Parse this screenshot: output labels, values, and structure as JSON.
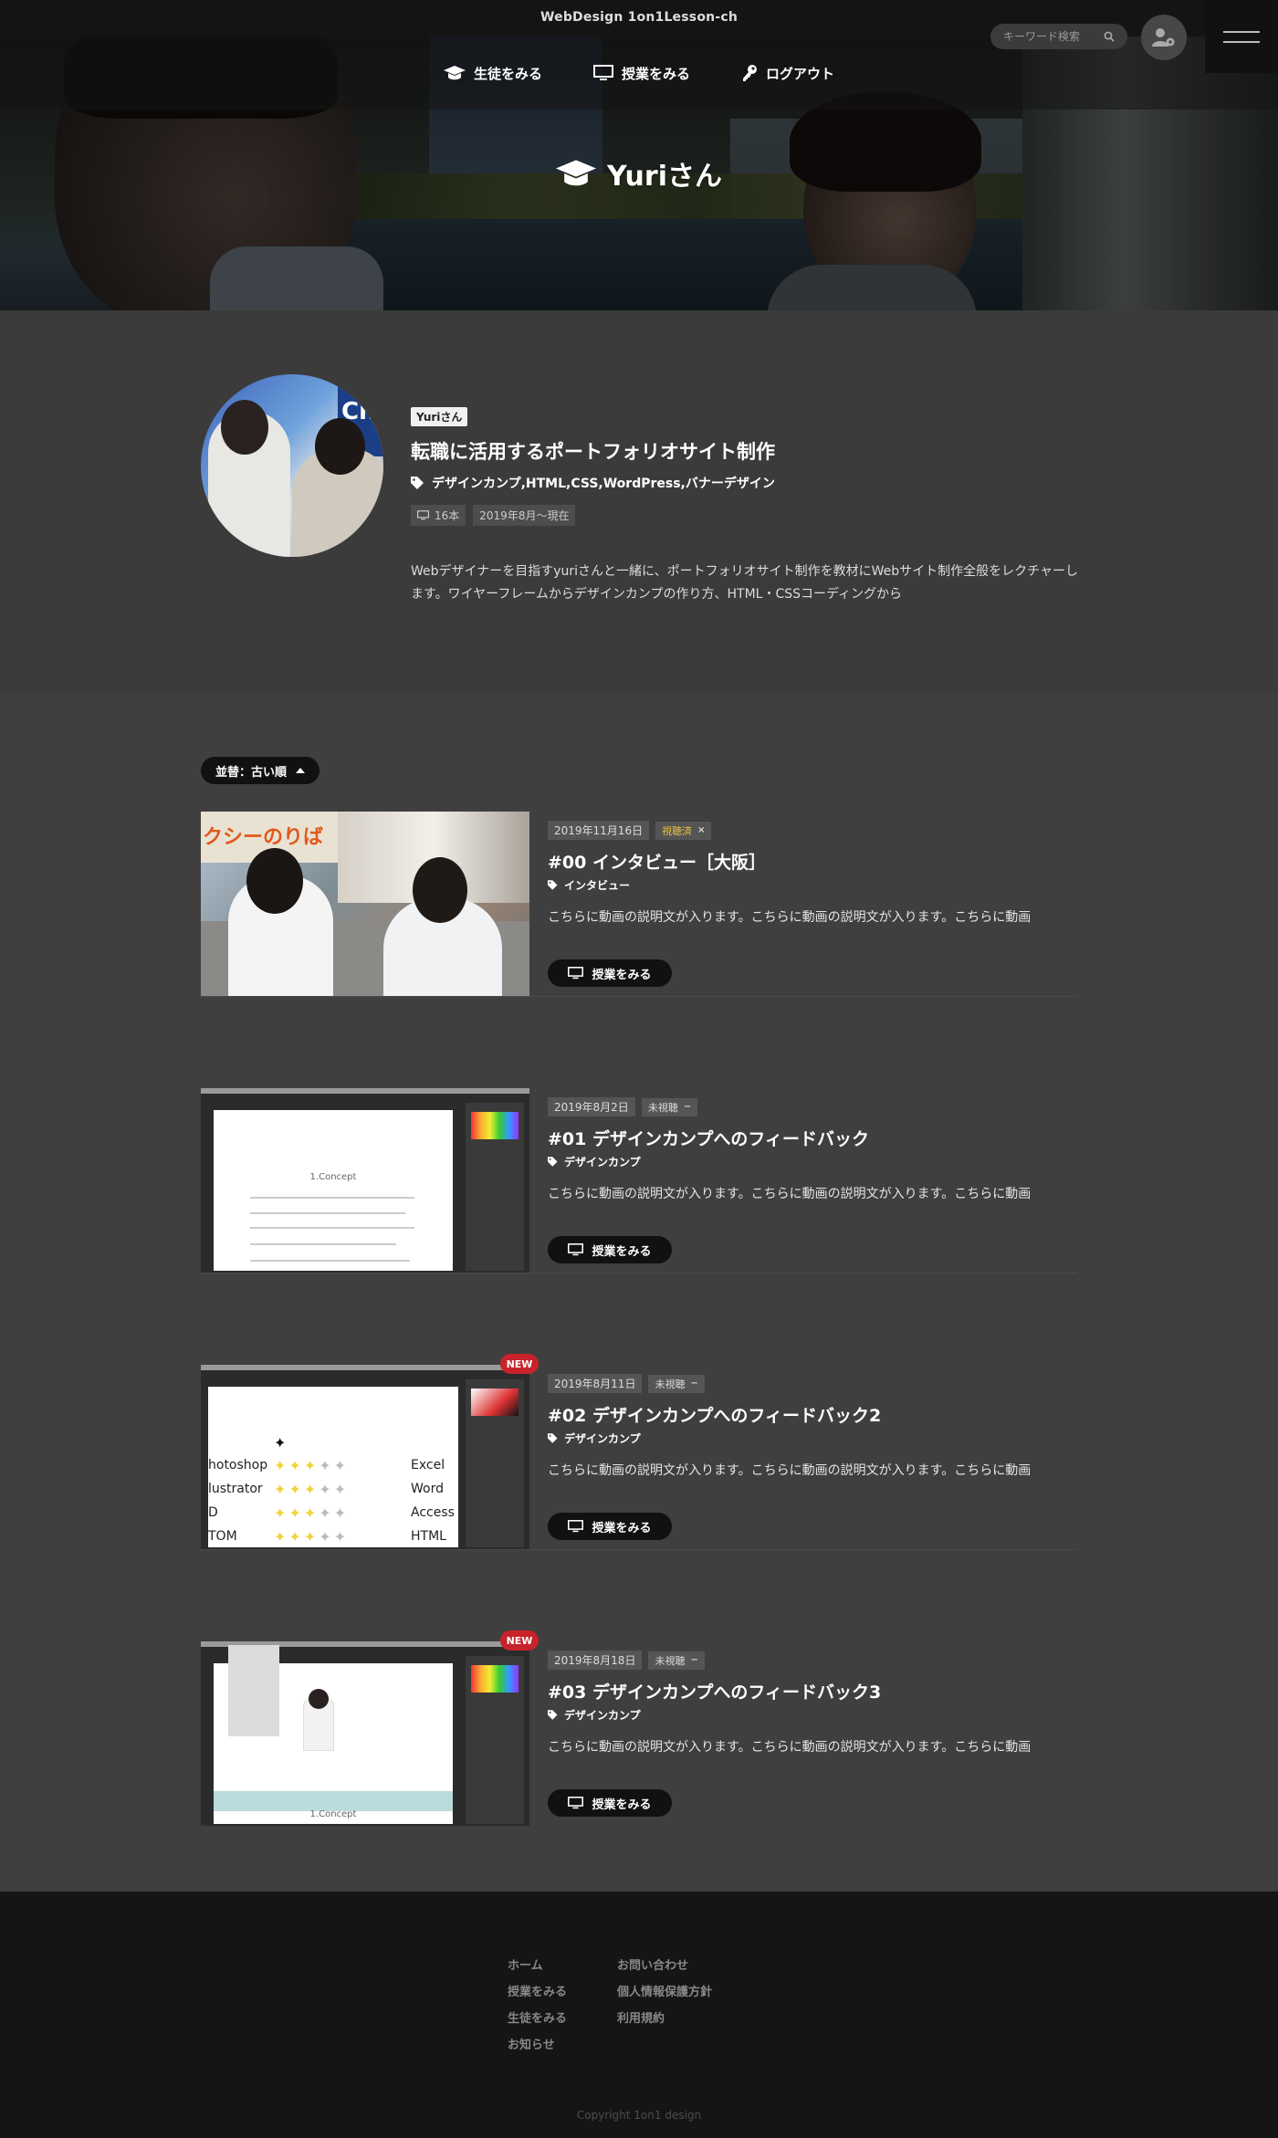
{
  "header": {
    "site_title": "WebDesign 1on1Lesson-ch",
    "search_placeholder": "キーワード検索",
    "nav": [
      {
        "label": "生徒をみる",
        "icon": "graduation-cap-icon"
      },
      {
        "label": "授業をみる",
        "icon": "monitor-icon"
      },
      {
        "label": "ログアウト",
        "icon": "key-icon"
      }
    ]
  },
  "hero": {
    "title": "Yuriさん"
  },
  "profile": {
    "name_tag": "Yuriさん",
    "title": "転職に活用するポートフォリオサイト制作",
    "tags": "デザインカンプ,HTML,CSS,WordPress,バナーデザイン",
    "lesson_count": "16本",
    "period": "2019年8月〜現在",
    "description": "Webデザイナーを目指すyuriさんと一緒に、ポートフォリオサイト制作を教材にWebサイト制作全般をレクチャーします。ワイヤーフレームからデザインカンプの作り方、HTML・CSSコーディングから"
  },
  "sort": {
    "label": "並替：古い順"
  },
  "lessons": [
    {
      "date": "2019年11月16日",
      "status": "視聴済",
      "status_mark": "×",
      "title": "#00 インタビュー［大阪］",
      "tag": "インタビュー",
      "desc": "こちらに動画の説明文が入ります。こちらに動画の説明文が入ります。こちらに動画",
      "button": "授業をみる",
      "thumb_text": "クシーのりば"
    },
    {
      "date": "2019年8月2日",
      "status": "未視聴",
      "status_mark": "−",
      "title": "#01 デザインカンプへのフィードバック",
      "tag": "デザインカンプ",
      "desc": "こちらに動画の説明文が入ります。こちらに動画の説明文が入ります。こちらに動画",
      "button": "授業をみる",
      "thumb_text": "1.Concept"
    },
    {
      "date": "2019年8月11日",
      "status": "未視聴",
      "status_mark": "−",
      "title": "#02 デザインカンプへのフィードバック2",
      "tag": "デザインカンプ",
      "desc": "こちらに動画の説明文が入ります。こちらに動画の説明文が入ります。こちらに動画",
      "button": "授業をみる",
      "badge": "NEW",
      "skills_left": [
        "hotoshop",
        "lustrator",
        "D",
        "TOM"
      ],
      "skills_right": [
        "Excel",
        "Word",
        "Access",
        "HTML"
      ]
    },
    {
      "date": "2019年8月18日",
      "status": "未視聴",
      "status_mark": "−",
      "title": "#03 デザインカンプへのフィードバック3",
      "tag": "デザインカンプ",
      "desc": "こちらに動画の説明文が入ります。こちらに動画の説明文が入ります。こちらに動画",
      "button": "授業をみる",
      "badge": "NEW",
      "thumb_text": "1.Concept"
    }
  ],
  "footer": {
    "col1": [
      "ホーム",
      "授業をみる",
      "生徒をみる",
      "お知らせ"
    ],
    "col2": [
      "お問い合わせ",
      "個人情報保護方針",
      "利用規約"
    ],
    "copyright": "Copyright 1on1 design"
  }
}
